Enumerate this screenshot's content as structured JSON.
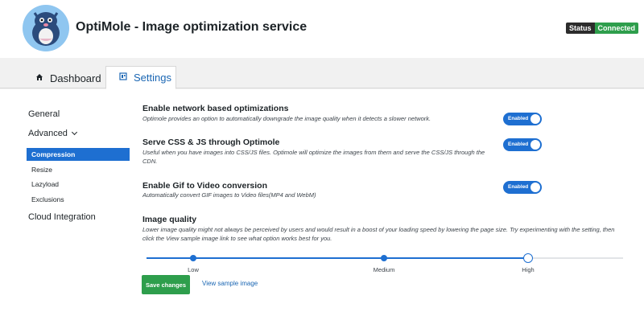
{
  "header": {
    "title": "OptiMole - Image optimization service",
    "status_label": "Status",
    "status_value": "Connected"
  },
  "tabs": [
    {
      "label": "Dashboard",
      "icon": "home-icon"
    },
    {
      "label": "Settings",
      "icon": "settings-icon"
    }
  ],
  "sidebar": {
    "general": "General",
    "advanced": "Advanced",
    "sub_items": [
      "Compression",
      "Resize",
      "Lazyload",
      "Exclusions"
    ],
    "active_item": "Compression",
    "cloud": "Cloud Integration"
  },
  "options": [
    {
      "title": "Enable network based optimizations",
      "description": "Optimole provides an option to automatically downgrade the image quality when it detects a slower network.",
      "toggle": "Enabled"
    },
    {
      "title": "Serve CSS & JS through Optimole",
      "description": "Useful when you have images into CSS/JS files. Optimole will optimize the images from them and serve the CSS/JS through the CDN.",
      "toggle": "Enabled"
    },
    {
      "title": "Enable Gif to Video conversion",
      "description": "Automatically convert GIF images to Video files(MP4 and WebM)",
      "toggle": "Enabled"
    }
  ],
  "quality": {
    "title": "Image quality",
    "description": "Lower image quality might not always be perceived by users and would result in a boost of your loading speed by lowering the page size. Try experimenting with the setting, then click the View sample image link to see what option works best for you.",
    "levels": [
      "Low",
      "Medium",
      "High"
    ],
    "selected": "High"
  },
  "actions": {
    "save": "Save changes",
    "view_sample": "View sample image"
  },
  "colors": {
    "accent": "#1e6fd1",
    "success": "#2e9e4c"
  }
}
